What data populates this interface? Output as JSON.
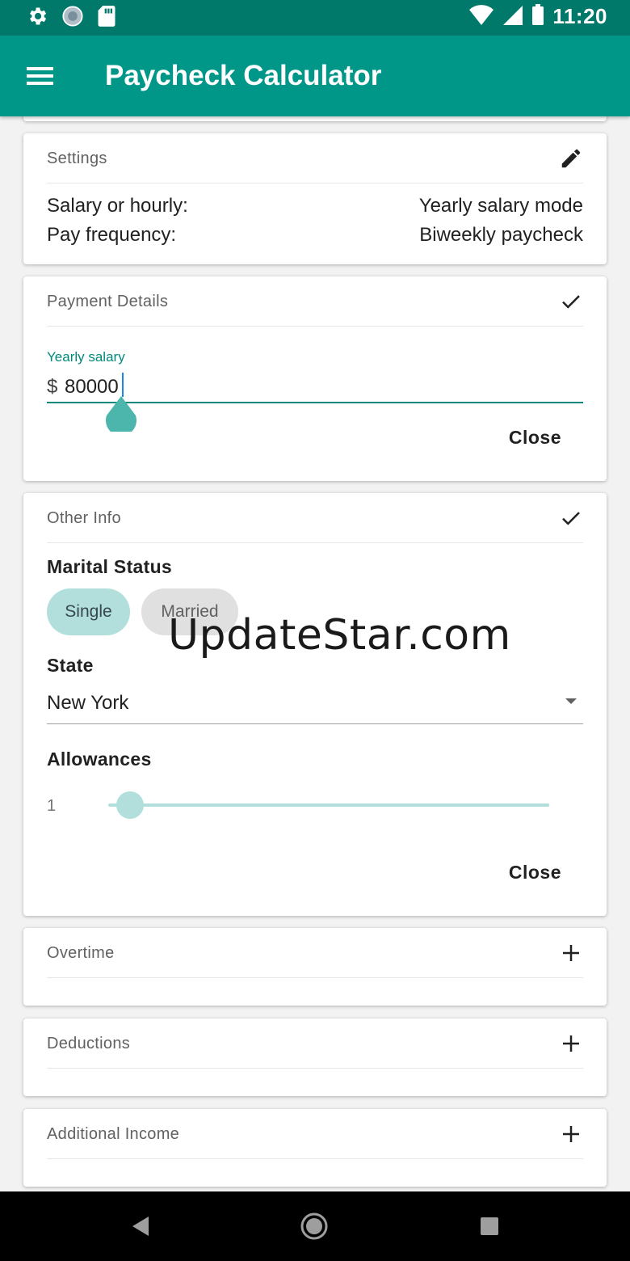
{
  "status_bar": {
    "time": "11:20"
  },
  "app_bar": {
    "title": "Paycheck Calculator"
  },
  "settings_card": {
    "title": "Settings",
    "rows": [
      {
        "label": "Salary or hourly:",
        "value": "Yearly salary mode"
      },
      {
        "label": "Pay frequency:",
        "value": "Biweekly paycheck"
      }
    ]
  },
  "payment_card": {
    "title": "Payment Details",
    "field_label": "Yearly salary",
    "currency": "$",
    "salary": "80000",
    "close_label": "Close"
  },
  "other_info_card": {
    "title": "Other Info",
    "marital_label": "Marital Status",
    "marital_options": [
      "Single",
      "Married"
    ],
    "marital_selected": "Single",
    "state_label": "State",
    "state_value": "New York",
    "allowances_label": "Allowances",
    "allowances_value": "1",
    "close_label": "Close"
  },
  "collapsed_cards": [
    {
      "title": "Overtime"
    },
    {
      "title": "Deductions"
    },
    {
      "title": "Additional Income"
    }
  ],
  "watermark": "UpdateStar.com",
  "colors": {
    "primary": "#009688",
    "primary_dark": "#00796b",
    "accent_light": "#b2dfdb",
    "teal_text": "#00897b"
  }
}
